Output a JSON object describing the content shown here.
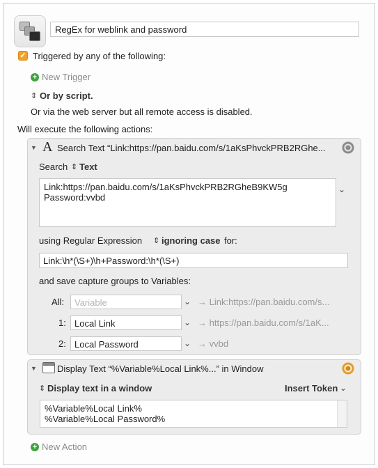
{
  "macro": {
    "name": "RegEx for weblink and password"
  },
  "triggers": {
    "checkbox_mark": "✓",
    "label": "Triggered by any of the following:",
    "new_trigger": "New Trigger",
    "by_script": "Or by script.",
    "web_server": "Or via the web server but all remote access is disabled."
  },
  "actions_heading": "Will execute the following actions:",
  "search_action": {
    "title": "Search Text “Link:https://pan.baidu.com/s/1aKsPhvckPRB2RGhe...",
    "search_label": "Search",
    "search_source": "Text",
    "text_line1": "Link:https://pan.baidu.com/s/1aKsPhvckPRB2RGheB9KW5g",
    "text_line2": "Password:vvbd",
    "using_label": "using Regular Expression",
    "case_option": "ignoring case",
    "for_label": "for:",
    "regex": "Link:\\h*(\\S+)\\h+Password:\\h*(\\S+)",
    "save_label": "and save capture groups to Variables:",
    "rows": [
      {
        "label": "All:",
        "value": "",
        "placeholder": "Variable",
        "result": "→ Link:https://pan.baidu.com/s..."
      },
      {
        "label": "1:",
        "value": "Local Link",
        "placeholder": "",
        "result": "→ https://pan.baidu.com/s/1aK..."
      },
      {
        "label": "2:",
        "value": "Local Password",
        "placeholder": "",
        "result": "→ vvbd"
      }
    ]
  },
  "display_action": {
    "title": "Display Text “%Variable%Local Link%...” in Window",
    "mode": "Display text in a window",
    "insert_token": "Insert Token",
    "text_line1": "%Variable%Local Link%",
    "text_line2": "%Variable%Local Password%"
  },
  "new_action": "New Action",
  "colors": {
    "accent_orange": "#f0a22c",
    "add_green": "#3aa53a"
  }
}
